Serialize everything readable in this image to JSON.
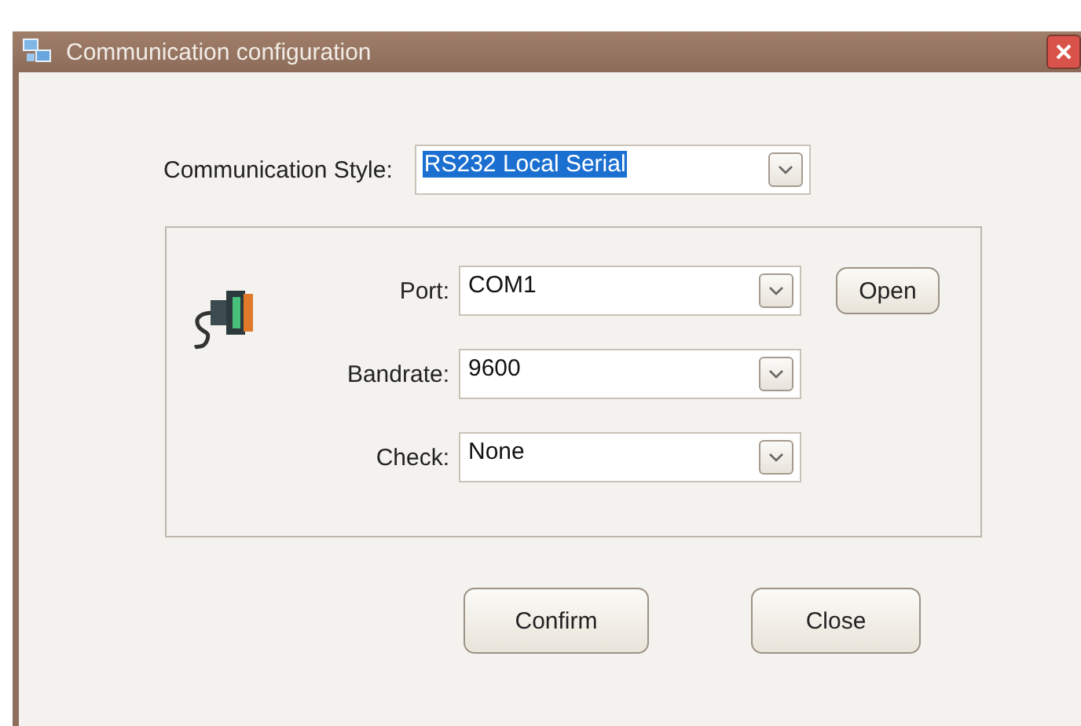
{
  "window": {
    "title": "Communication configuration"
  },
  "style": {
    "label": "Communication Style:",
    "value": "RS232 Local Serial",
    "selected": true
  },
  "fields": [
    {
      "label": "Port:",
      "value": "COM1",
      "button": "Open"
    },
    {
      "label": "Bandrate:",
      "value": "9600"
    },
    {
      "label": "Check:",
      "value": "None"
    }
  ],
  "buttons": [
    "Confirm",
    "Close"
  ]
}
